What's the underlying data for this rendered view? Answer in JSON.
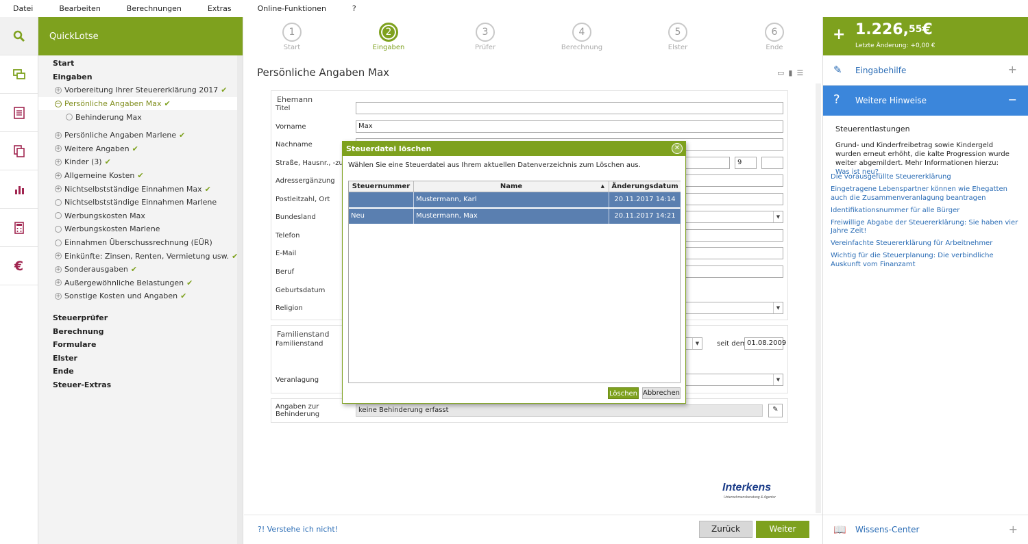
{
  "menu": [
    "Datei",
    "Bearbeiten",
    "Berechnungen",
    "Extras",
    "Online-Funktionen",
    "?"
  ],
  "sidebar_icons": [
    "search-icon",
    "chat-icon",
    "document-icon",
    "copy-icon",
    "bar-chart-icon",
    "calculator-icon",
    "euro-icon"
  ],
  "nav": {
    "title": "QuickLotse",
    "sections_top": [
      "Start",
      "Eingaben"
    ],
    "items": [
      {
        "label": "Vorbereitung Ihrer Steuererklärung 2017",
        "bullet": "+",
        "check": true
      },
      {
        "label": "Persönliche Angaben Max",
        "bullet": "−",
        "check": true,
        "active": true
      },
      {
        "label": "Behinderung Max",
        "bullet": "",
        "check": false,
        "sub": true
      },
      {
        "label": "Persönliche Angaben Marlene",
        "bullet": "+",
        "check": true
      },
      {
        "label": "Weitere Angaben",
        "bullet": "+",
        "check": true
      },
      {
        "label": "Kinder (3)",
        "bullet": "+",
        "check": true
      },
      {
        "label": "Allgemeine Kosten",
        "bullet": "+",
        "check": true
      },
      {
        "label": "Nichtselbstständige Einnahmen Max",
        "bullet": "+",
        "check": true
      },
      {
        "label": "Nichtselbstständige Einnahmen Marlene",
        "bullet": "",
        "check": false
      },
      {
        "label": "Werbungskosten Max",
        "bullet": "",
        "check": false
      },
      {
        "label": "Werbungskosten Marlene",
        "bullet": "",
        "check": false
      },
      {
        "label": "Einnahmen Überschussrechnung (EÜR)",
        "bullet": "",
        "check": false
      },
      {
        "label": "Einkünfte: Zinsen, Renten, Vermietung usw.",
        "bullet": "+",
        "check": true
      },
      {
        "label": "Sonderausgaben",
        "bullet": "+",
        "check": true
      },
      {
        "label": "Außergewöhnliche Belastungen",
        "bullet": "+",
        "check": true
      },
      {
        "label": "Sonstige Kosten und Angaben",
        "bullet": "+",
        "check": true
      }
    ],
    "sections_bottom": [
      "Steuerprüfer",
      "Berechnung",
      "Formulare",
      "Elster",
      "Ende",
      "Steuer-Extras"
    ],
    "check_mark": "✔"
  },
  "steps": [
    {
      "num": "1",
      "label": "Start"
    },
    {
      "num": "2",
      "label": "Eingaben",
      "active": true
    },
    {
      "num": "3",
      "label": "Prüfer"
    },
    {
      "num": "4",
      "label": "Berechnung"
    },
    {
      "num": "5",
      "label": "Elster"
    },
    {
      "num": "6",
      "label": "Ende"
    }
  ],
  "page_title": "Persönliche Angaben Max",
  "form": {
    "ehemann_title": "Ehemann",
    "titel_label": "Titel",
    "vorname_label": "Vorname",
    "vorname_value": "Max",
    "nachname_label": "Nachname",
    "strasse_label": "Straße, Hausnr., -zusatz",
    "hausnr_value": "9",
    "adress_label": "Adressergänzung",
    "plz_label": "Postleitzahl, Ort",
    "bundesland_label": "Bundesland",
    "telefon_label": "Telefon",
    "email_label": "E-Mail",
    "beruf_label": "Beruf",
    "geburtsdatum_label": "Geburtsdatum",
    "religion_label": "Religion",
    "familienstand_title": "Familienstand",
    "familienstand_label": "Familienstand",
    "seit_dem_label": "seit dem",
    "seit_dem_value": "01.08.2009",
    "veranlagung_label": "Veranlagung",
    "behinderung_label": "Angaben zur Behinderung",
    "behinderung_value": "keine Behinderung erfasst"
  },
  "bottom": {
    "help_link": "?! Verstehe ich nicht!",
    "back": "Zurück",
    "next": "Weiter"
  },
  "logo": {
    "text": "Interkens",
    "sub": "Unternehmensberatung & Agentur"
  },
  "right_panel": {
    "amount_main": "1.226,",
    "amount_cents": "55",
    "amount_currency": "€",
    "last_change": "Letzte Änderung: +0,00 €",
    "eingabehilfe": "Eingabehilfe",
    "weitere_hinweise": "Weitere Hinweise",
    "hint_title": "Steuerentlastungen",
    "hint_text": "Grund- und Kinderfreibetrag sowie Kindergeld wurden erneut erhöht, die kalte Progression wurde weiter abgemildert. Mehr Informationen hierzu: ",
    "hint_link": "Was ist neu?",
    "links": [
      "Die vorausgefüllte Steuererklärung",
      "Eingetragene Lebenspartner können wie Ehegatten auch die Zusammenveranlagung beantragen",
      "Identifikationsnummer für alle Bürger",
      "Freiwillige Abgabe der Steuererklärung: Sie haben vier Jahre Zeit!",
      "Vereinfachte Steuererklärung für Arbeitnehmer",
      "Wichtig für die Steuerplanung: Die verbindliche Auskunft vom Finanzamt"
    ],
    "wissens_center": "Wissens-Center"
  },
  "dialog": {
    "title": "Steuerdatei löschen",
    "message": "Wählen Sie eine Steuerdatei aus Ihrem aktuellen Datenverzeichnis zum Löschen aus.",
    "columns": [
      "Steuernummer",
      "Name",
      "Änderungsdatum"
    ],
    "rows": [
      {
        "steuernummer": "",
        "name": "Mustermann, Karl",
        "datum": "20.11.2017 14:14"
      },
      {
        "steuernummer": "Neu",
        "name": "Mustermann, Max",
        "datum": "20.11.2017 14:21"
      }
    ],
    "delete": "Löschen",
    "cancel": "Abbrechen"
  }
}
